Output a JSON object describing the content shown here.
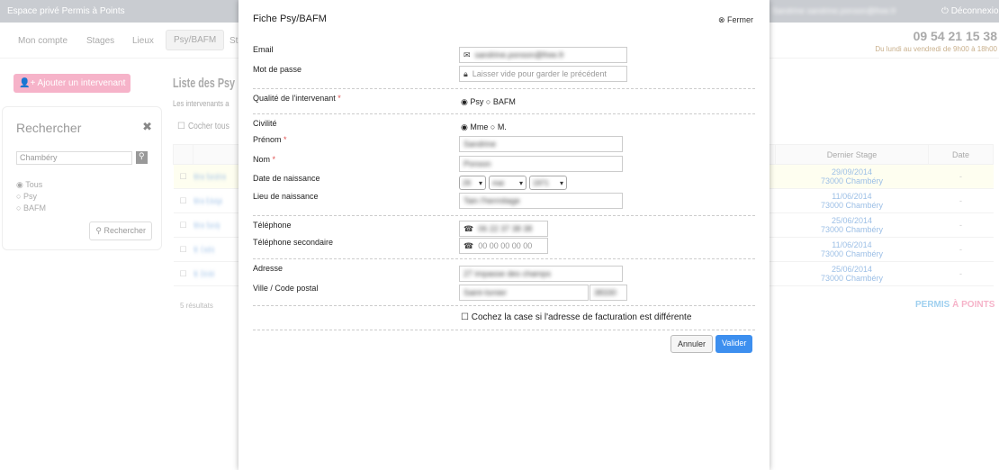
{
  "topbar": {
    "title": "Espace privé Permis à Points",
    "user": "Sandrine sandrine.ponson@free.fr",
    "logout": "Déconnexion"
  },
  "nav": {
    "items": [
      "Mon compte",
      "Stages",
      "Lieux",
      "Psy/BAFM",
      "St"
    ],
    "active": 3
  },
  "contact": {
    "phone": "09 54 21 15 38",
    "hours": "Du lundi au vendredi de 9h00 à 18h00"
  },
  "sidebar": {
    "add_button": "Ajouter un intervenant",
    "search_title": "Rechercher",
    "search_value": "Chambéry",
    "filters": [
      "Tous",
      "Psy",
      "BAFM"
    ],
    "selected_filter": "Tous",
    "search_button": "Rechercher"
  },
  "list": {
    "title": "Liste des Psy",
    "subtitle": "Les intervenants a",
    "check_all": "Cocher tous",
    "headers": [
      "Dernier Stage",
      "Date"
    ],
    "rows": [
      {
        "name": "Mme Sandrine",
        "stage_date": "29/09/2014",
        "stage_place": "73000 Chambéry",
        "date": "-"
      },
      {
        "name": "Mme Edwige",
        "stage_date": "11/06/2014",
        "stage_place": "73000 Chambéry",
        "date": "-"
      },
      {
        "name": "Mme Sandy",
        "stage_date": "25/06/2014",
        "stage_place": "73000 Chambéry",
        "date": "-"
      },
      {
        "name": "M. Cedric",
        "stage_date": "11/06/2014",
        "stage_place": "73000 Chambéry",
        "date": "-"
      },
      {
        "name": "M. Dimitri",
        "stage_date": "25/06/2014",
        "stage_place": "73000 Chambéry",
        "date": "-"
      }
    ],
    "count": "5 résultats"
  },
  "logo": {
    "a": "PERMIS",
    "b": "À",
    "c": "POINTS"
  },
  "modal": {
    "title": "Fiche Psy/BAFM",
    "close": "Fermer",
    "email_label": "Email",
    "email": "sandrine.ponson@free.fr",
    "password_label": "Mot de passe",
    "password_placeholder": "Laisser vide pour garder le précédent",
    "quality_label": "Qualité de l'intervenant",
    "quality_options": [
      "Psy",
      "BAFM"
    ],
    "quality_selected": "Psy",
    "civility_label": "Civilité",
    "civility_options": [
      "Mme",
      "M."
    ],
    "civility_selected": "Mme",
    "firstname_label": "Prénom",
    "firstname": "Sandrine",
    "lastname_label": "Nom",
    "lastname": "Ponson",
    "birthdate_label": "Date de naissance",
    "birth_day": "29",
    "birth_month": "mai",
    "birth_year": "1971",
    "birthplace_label": "Lieu de naissance",
    "birthplace": "Tain l'hermitage",
    "phone_label": "Téléphone",
    "phone": "06 22 37 38 38",
    "phone2_label": "Téléphone secondaire",
    "phone2_placeholder": "00 00 00 00 00",
    "address_label": "Adresse",
    "address": "27 impasse des champs",
    "city_label": "Ville / Code postal",
    "city": "Saint-Ismier",
    "postal": "38330",
    "billing_checkbox": "Cochez la case si l'adresse de facturation est différente",
    "cancel": "Annuler",
    "submit": "Valider"
  }
}
